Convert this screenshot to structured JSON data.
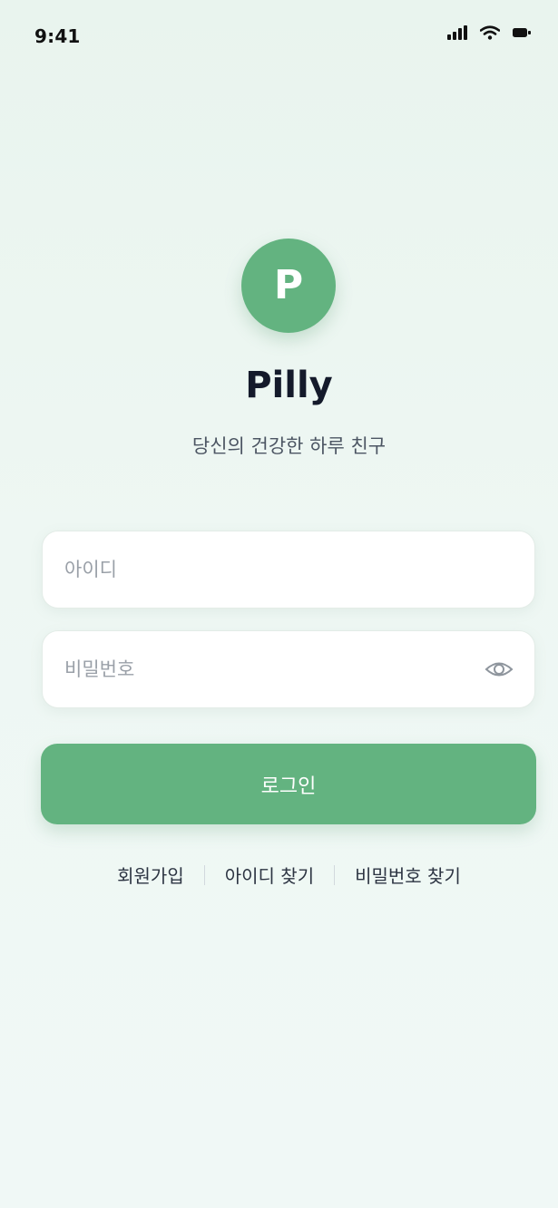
{
  "status_bar": {
    "time": "9:41",
    "icons": [
      "signal-icon",
      "wifi-icon",
      "battery-icon"
    ]
  },
  "brand": {
    "logo_letter": "P",
    "app_name": "Pilly",
    "tagline": "당신의 건강한 하루 친구",
    "accent_color": "#63b380"
  },
  "form": {
    "id_placeholder": "아이디",
    "id_value": "",
    "password_placeholder": "비밀번호",
    "password_value": "",
    "password_toggle_icon": "eye-icon",
    "login_label": "로그인"
  },
  "links": {
    "signup": "회원가입",
    "find_id": "아이디 찾기",
    "find_password": "비밀번호 찾기"
  }
}
